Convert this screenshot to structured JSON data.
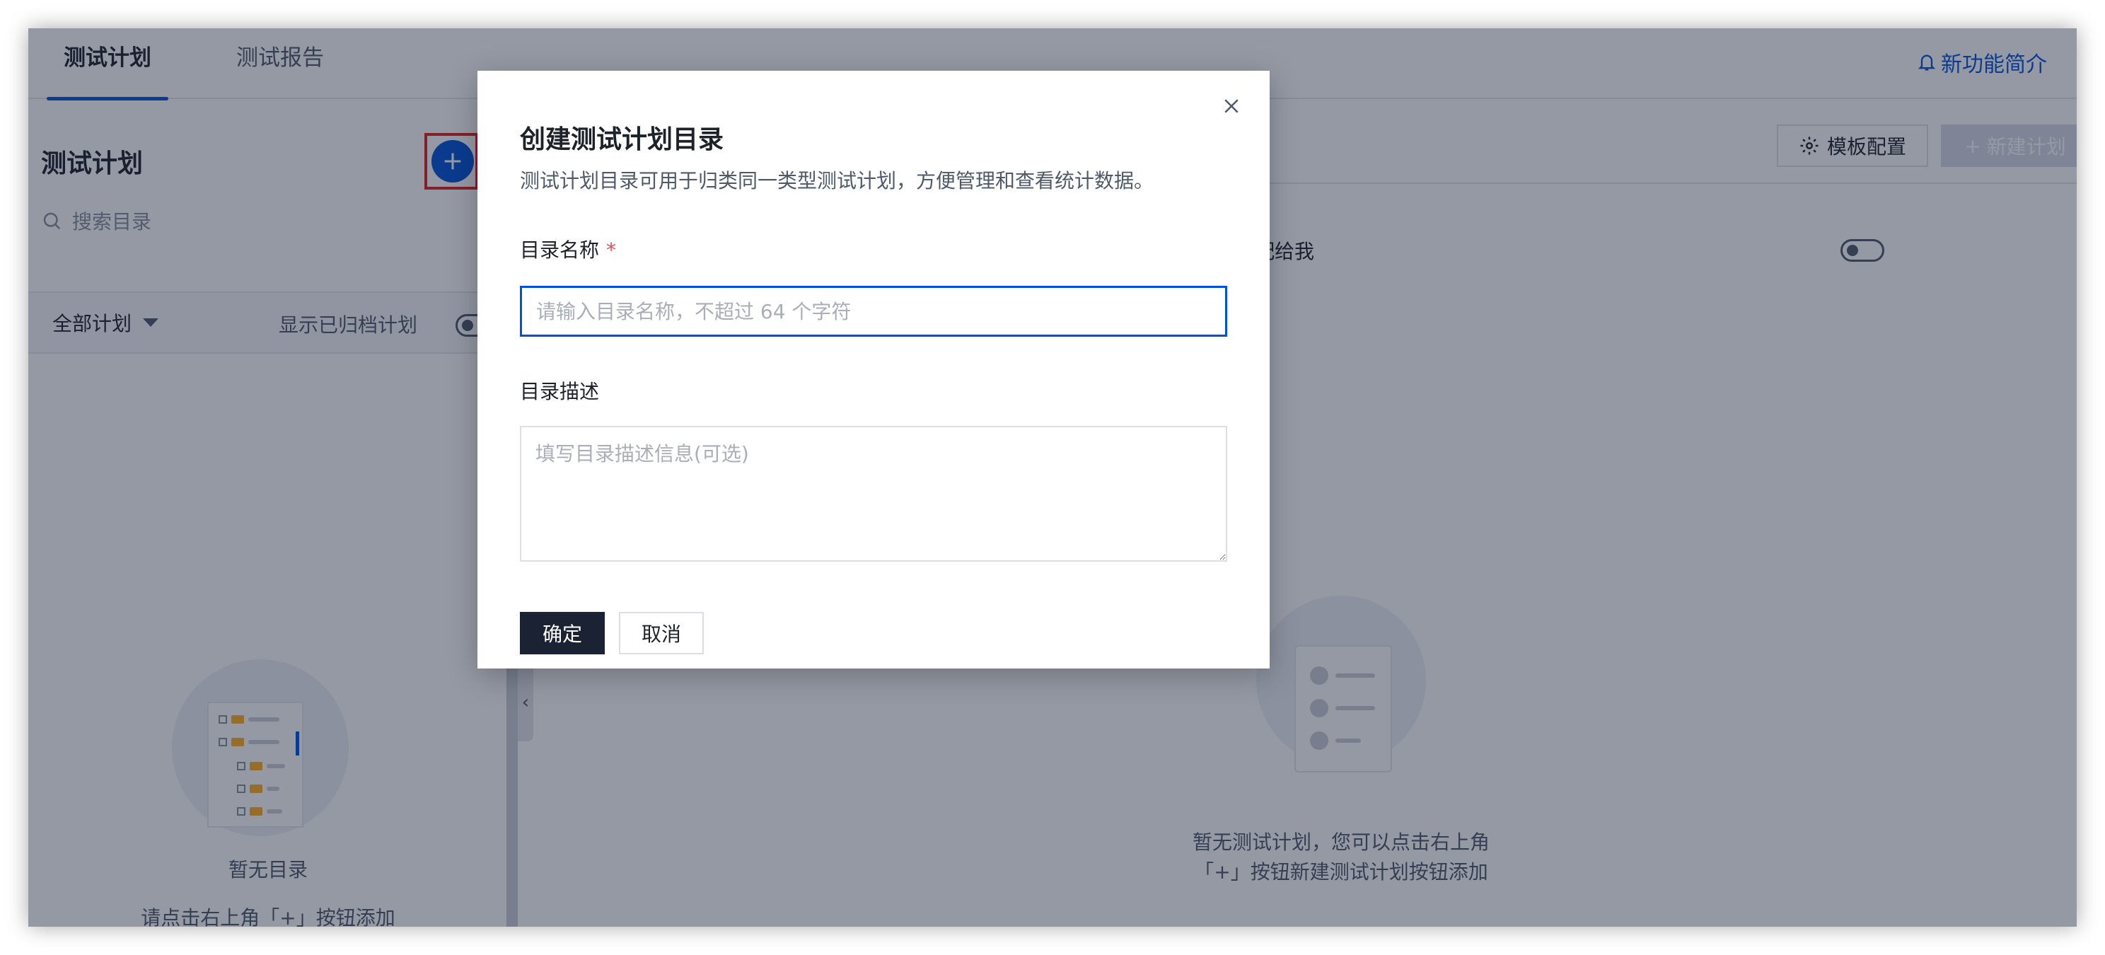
{
  "tabs": [
    {
      "label": "测试计划",
      "active": true
    },
    {
      "label": "测试报告",
      "active": false
    }
  ],
  "whats_new": {
    "label": "新功能简介",
    "icon": "bell-icon"
  },
  "left_panel": {
    "title": "测试计划",
    "add_icon": "plus-icon",
    "search_placeholder": "搜索目录",
    "scope_filter": "全部计划",
    "show_archived_label": "显示已归档计划",
    "show_archived": false,
    "empty_title": "暂无目录",
    "empty_hint": "请点击右上角「+」按钮添加"
  },
  "right_panel": {
    "template_button": "模板配置",
    "new_plan_button": "新建计划",
    "assigned_to_me_label": "配给我",
    "assigned_to_me": false,
    "empty_line1": "暂无测试计划，您可以点击右上角",
    "empty_line2": "「+」按钮新建测试计划按钮添加"
  },
  "modal": {
    "title": "创建测试计划目录",
    "description": "测试计划目录可用于归类同一类型测试计划，方便管理和查看统计数据。",
    "name_label": "目录名称",
    "required_mark": "*",
    "name_placeholder": "请输入目录名称，不超过 64 个字符",
    "name_value": "",
    "desc_label": "目录描述",
    "desc_placeholder": "填写目录描述信息(可选)",
    "desc_value": "",
    "confirm": "确定",
    "cancel": "取消"
  },
  "colors": {
    "brand_blue": "#0052d9",
    "primary_dark": "#1a2234",
    "required_red": "#e34d59",
    "highlight_red": "#e02020"
  }
}
